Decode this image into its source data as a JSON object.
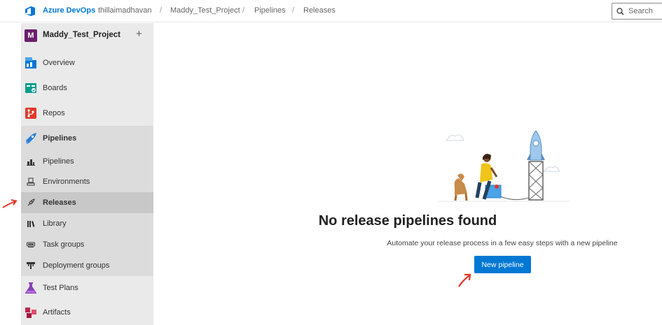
{
  "header": {
    "brand": "Azure DevOps",
    "breadcrumbs": [
      "thillaimadhavan",
      "Maddy_Test_Project",
      "Pipelines",
      "Releases"
    ],
    "search_placeholder": "Search"
  },
  "sidebar": {
    "project_initial": "M",
    "project_name": "Maddy_Test_Project",
    "add_label": "+",
    "items": [
      {
        "label": "Overview",
        "icon": "overview-icon"
      },
      {
        "label": "Boards",
        "icon": "boards-icon"
      },
      {
        "label": "Repos",
        "icon": "repos-icon"
      },
      {
        "label": "Pipelines",
        "icon": "pipelines-icon"
      },
      {
        "label": "Pipelines",
        "icon": "pipelines-sub-icon"
      },
      {
        "label": "Environments",
        "icon": "environments-icon"
      },
      {
        "label": "Releases",
        "icon": "releases-icon"
      },
      {
        "label": "Library",
        "icon": "library-icon"
      },
      {
        "label": "Task groups",
        "icon": "task-groups-icon"
      },
      {
        "label": "Deployment groups",
        "icon": "deployment-groups-icon"
      },
      {
        "label": "Test Plans",
        "icon": "test-plans-icon"
      },
      {
        "label": "Artifacts",
        "icon": "artifacts-icon"
      }
    ]
  },
  "main": {
    "empty_title": "No release pipelines found",
    "empty_description": "Automate your release process in a few easy steps with a new pipeline",
    "cta_label": "New pipeline"
  },
  "colors": {
    "accent": "#0078d4",
    "annotation": "#e03a2a",
    "sidebar_bg": "#eaeaea",
    "selected_bg": "#c8c8c8"
  }
}
